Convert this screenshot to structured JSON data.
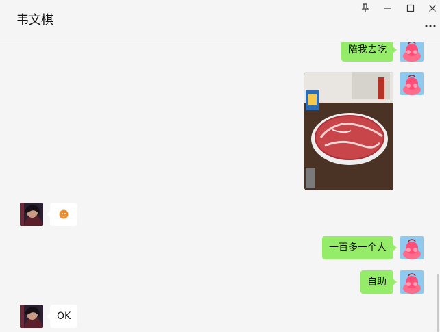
{
  "header": {
    "chat_title": "韦文棋"
  },
  "window_controls": {
    "pin_icon": "pin-icon",
    "minimize_icon": "minimize-icon",
    "maximize_icon": "maximize-icon",
    "close_icon": "close-icon",
    "more_icon": "more-icon"
  },
  "messages": [
    {
      "sender": "me",
      "type": "text",
      "text": "陪我去吃"
    },
    {
      "sender": "me",
      "type": "image",
      "image": "photo of a platter of sliced raw meat on a restaurant table"
    },
    {
      "sender": "other",
      "type": "sticker",
      "sticker": "small orange emoji sticker"
    },
    {
      "sender": "me",
      "type": "text",
      "text": "一百多一个人"
    },
    {
      "sender": "me",
      "type": "text",
      "text": "自助"
    },
    {
      "sender": "other",
      "type": "text",
      "text": "OK"
    }
  ],
  "colors": {
    "my_bubble": "#95ec69",
    "other_bubble": "#ffffff",
    "background": "#f5f5f5"
  }
}
